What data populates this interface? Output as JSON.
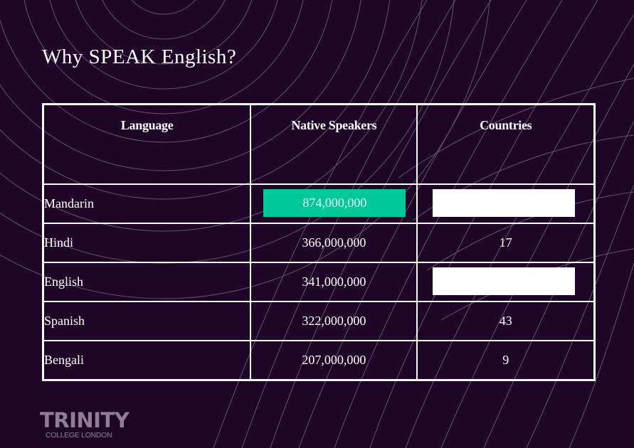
{
  "slide": {
    "title": "Why SPEAK English?",
    "colors": {
      "background": "#1f0628",
      "highlight_green": "#00c89b",
      "highlight_white": "#ffffff",
      "logo": "#8f7e96"
    }
  },
  "table": {
    "headers": [
      "Language",
      "Native Speakers",
      "Countries"
    ],
    "rows": [
      {
        "language": "Mandarin",
        "speakers": "874,000,000",
        "countries": "",
        "speakers_highlight": "green",
        "countries_highlight": "white"
      },
      {
        "language": "Hindi",
        "speakers": "366,000,000",
        "countries": "17"
      },
      {
        "language": "English",
        "speakers": "341,000,000",
        "countries": "",
        "countries_highlight": "white"
      },
      {
        "language": "Spanish",
        "speakers": "322,000,000",
        "countries": "43"
      },
      {
        "language": "Bengali",
        "speakers": "207,000,000",
        "countries": "9"
      }
    ]
  },
  "logo": {
    "name": "TRINITY",
    "subtitle": "COLLEGE LONDON"
  }
}
